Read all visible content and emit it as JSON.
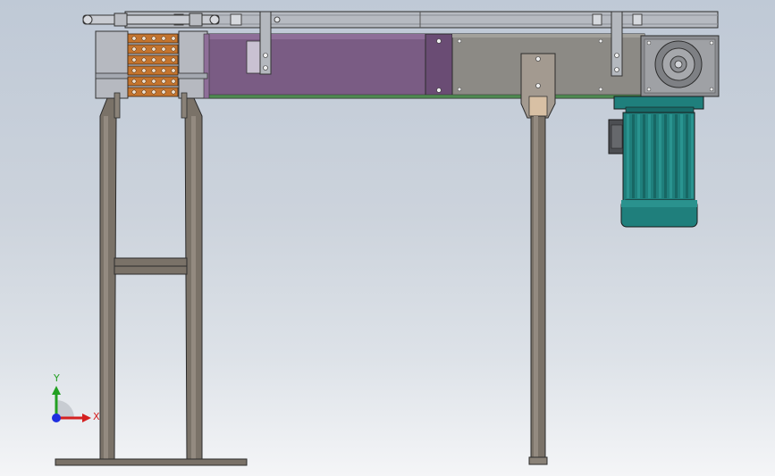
{
  "triad": {
    "x_label": "X",
    "y_label": "Y",
    "x_color": "#d42020",
    "y_color": "#22a022",
    "z_color": "#1e2ee0"
  },
  "colors": {
    "frame_edge": "#3c3630",
    "frame_fill": "#7a7268",
    "frame_fill_light": "#9a9086",
    "conveyor_body": "#7a5c84",
    "conveyor_body_dark": "#664a70",
    "panel_grey": "#8a8884",
    "rail_grey": "#b0b4bb",
    "sprocket_orange": "#c4742e",
    "motor_teal": "#1f7f7c",
    "motor_teal_dark": "#155e5b",
    "gearbox_grey": "#8c8e92",
    "wood": "#d8c0a4"
  }
}
